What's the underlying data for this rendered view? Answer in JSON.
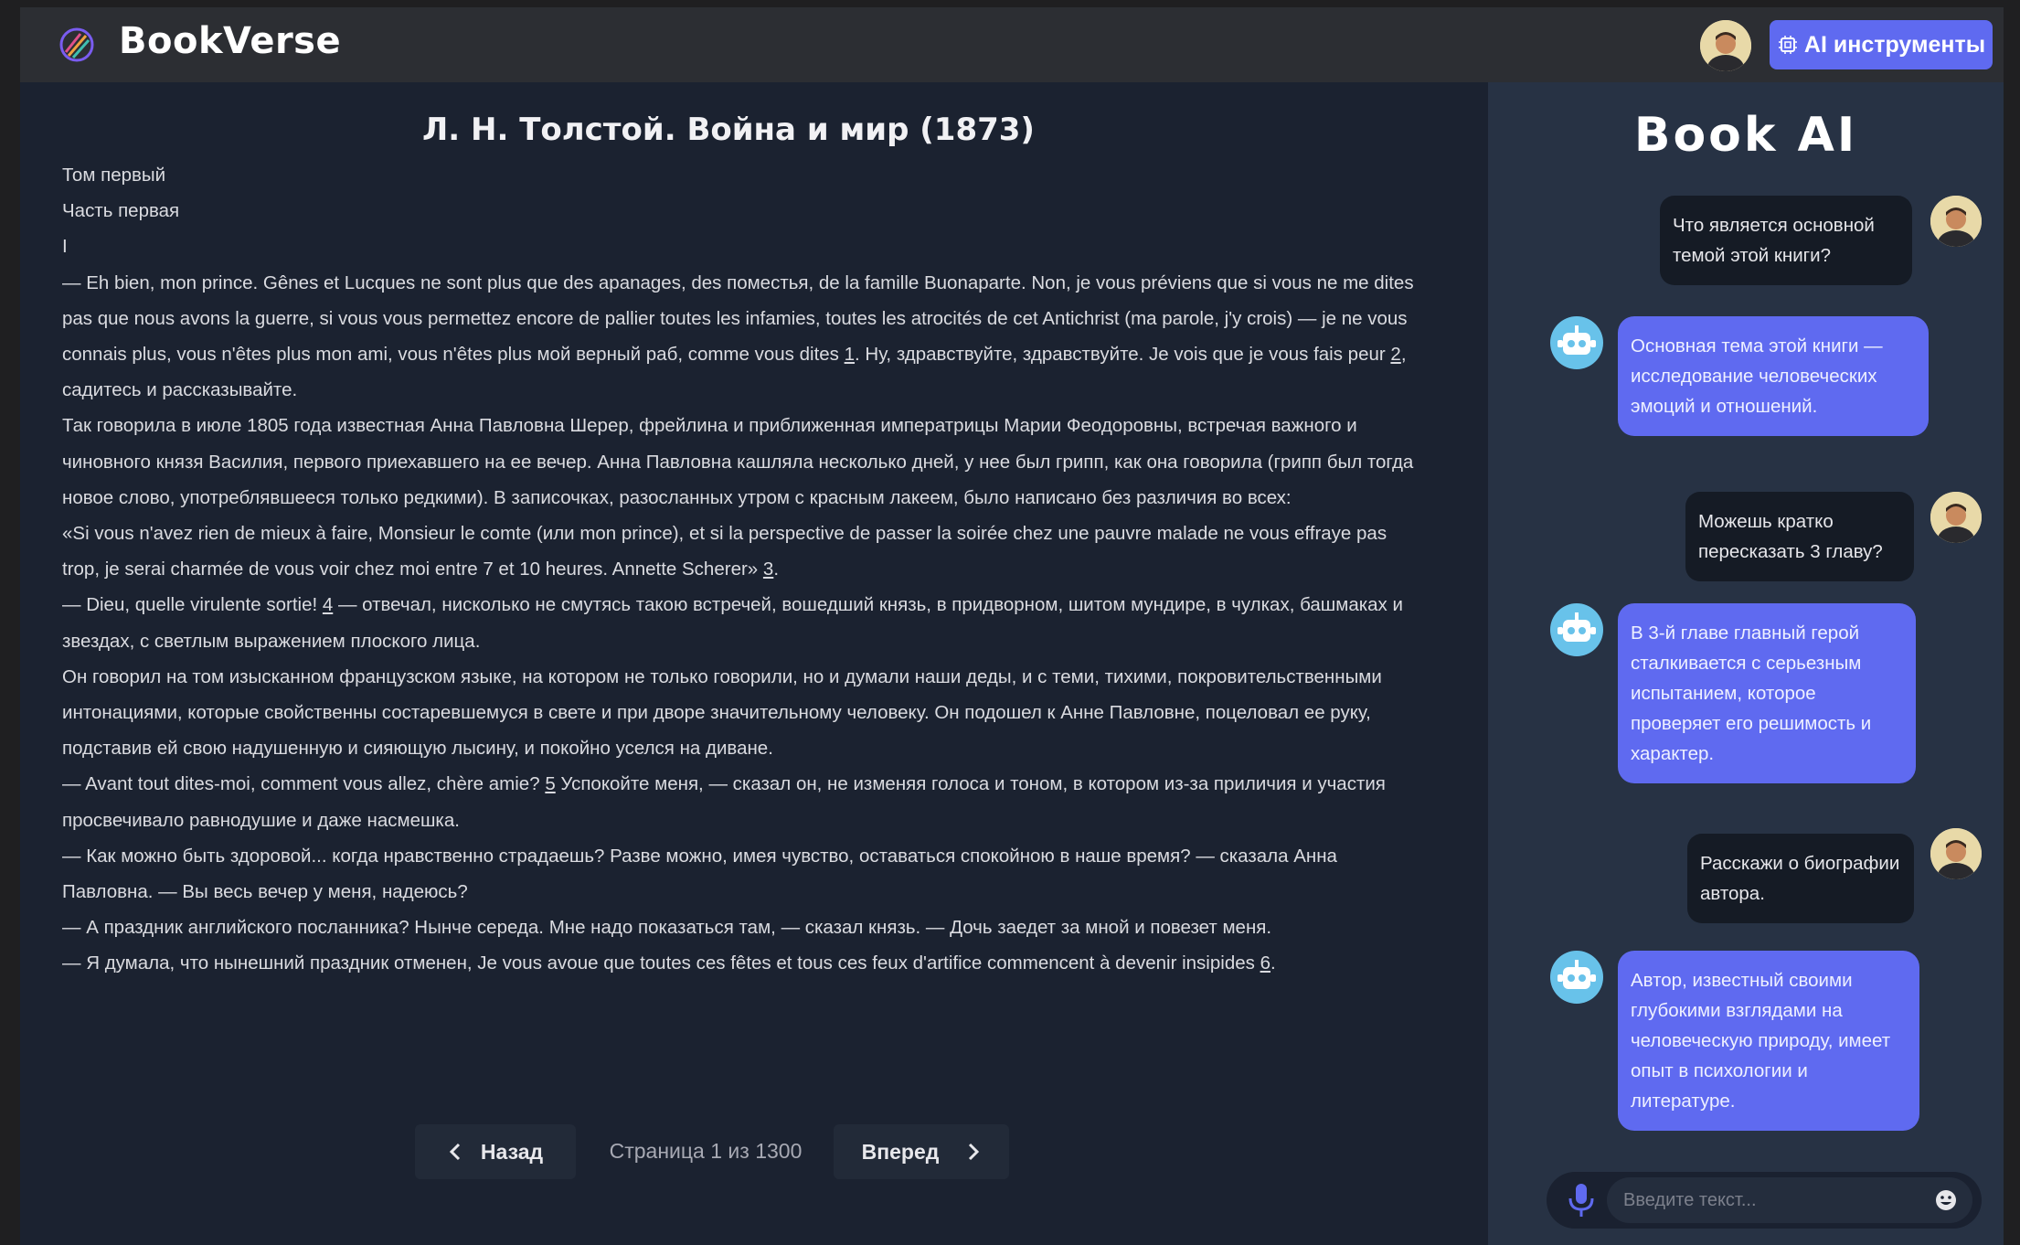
{
  "header": {
    "brand": "BookVerse",
    "ai_tools_label": "AI инструменты"
  },
  "book": {
    "title": "Л. Н. Толстой. Война и мир (1873)",
    "paragraphs": [
      "Том первый",
      "Часть первая",
      "I",
      "— Eh bien, mon prince. Gênes et Lucques ne sont plus que des apanages, des поместья, de la famille Buonaparte. Non, je vous préviens que si vous ne me dites pas que nous avons la guerre, si vous vous permettez encore de pallier toutes les infamies, toutes les atrocités de cet Antichrist (ma parole, j'y crois) — je ne vous connais plus, vous n'êtes plus mon ami, vous n'êtes plus мой верный раб, comme vous dites",
      "Так говорила в июле 1805 года известная Анна Павловна Шерер, фрейлина и приближенная императрицы Марии Феодоровны, встречая важного и чиновного князя Василия, первого приехавшего на ее вечер. Анна Павловна кашляла несколько дней, у нее был грипп, как она говорила (грипп был тогда новое слово, употреблявшееся только редкими). В записочках, разосланных утром с красным лакеем, было написано без различия во всех:",
      "«Si vous n'avez rien de mieux à faire, Monsieur le comte (или mon prince), et si la perspective de passer la soirée chez une pauvre malade ne vous effraye pas trop, je serai charmée de vous voir chez moi entre 7 et 10 heures. Annette Scherer»",
      "— Dieu, quelle virulente sortie!",
      "Он говорил на том изысканном французском языке, на котором не только говорили, но и думали наши деды, и с теми, тихими, покровительственными интонациями, которые свойственны состаревшемуся в свете и при дворе значительному человеку. Он подошел к Анне Павловне, поцеловал ее руку, подставив ей свою надушенную и сияющую лысину, и покойно уселся на диване.",
      "— Avant tout dites-moi, comment vous allez, chère amie?",
      "— Как можно быть здоровой... когда нравственно страдаешь? Разве можно, имея чувство, оставаться спокойною в наше время? — сказала Анна Павловна. — Вы весь вечер у меня, надеюсь?",
      "— А праздник английского посланника? Нынче середа. Мне надо показаться там, — сказал князь. — Дочь заедет за мной и повезет меня.",
      "— Я думала, что нынешний праздник отменен, Je vous avoue que toutes ces fêtes et tous ces feux d'artifice commencent à devenir insipides"
    ],
    "p4_tail_a": ". Ну, здравствуйте, здравствуйте. Je vois que je vous fais peur",
    "p4_tail_b": ", садитесь и рассказывайте.",
    "p6_tail": ".",
    "p7_tail": " — отвечал, нисколько не смутясь такою встречей, вошедший князь, в придворном, шитом мундире, в чулках, башмаках и звездах, с светлым выражением плоского лица.",
    "p9_tail": " Успокойте меня, — сказал он, не изменяя голоса и тоном, в котором из-за приличия и участия просвечивало равнодушие и даже насмешка.",
    "p12_tail": ".",
    "refs": [
      "1",
      "2",
      "3",
      "4",
      "5",
      "6"
    ]
  },
  "pager": {
    "back_label": "Назад",
    "next_label": "Вперед",
    "page_info": "Страница 1 из 1300"
  },
  "ai": {
    "title": "Book AI",
    "messages": [
      {
        "role": "user",
        "text": "Что является основной темой этой книги?"
      },
      {
        "role": "bot",
        "text": "Основная тема этой книги — исследование человеческих эмоций и отношений."
      },
      {
        "role": "user",
        "text": "Можешь кратко пересказать 3 главу?"
      },
      {
        "role": "bot",
        "text": "В 3-й главе главный герой сталкивается с серьезным испытанием, которое проверяет его решимость и характер."
      },
      {
        "role": "user",
        "text": "Расскажи о биографии автора."
      },
      {
        "role": "bot",
        "text": "Автор, известный своими глубокими взглядами на человеческую природу, имеет опыт в психологии и литературе."
      }
    ],
    "input_placeholder": "Введите текст..."
  },
  "colors": {
    "accent": "#5f6af0",
    "panel_bg": "#273244",
    "reader_bg": "#1b2230",
    "header_bg": "#2c2e33"
  }
}
